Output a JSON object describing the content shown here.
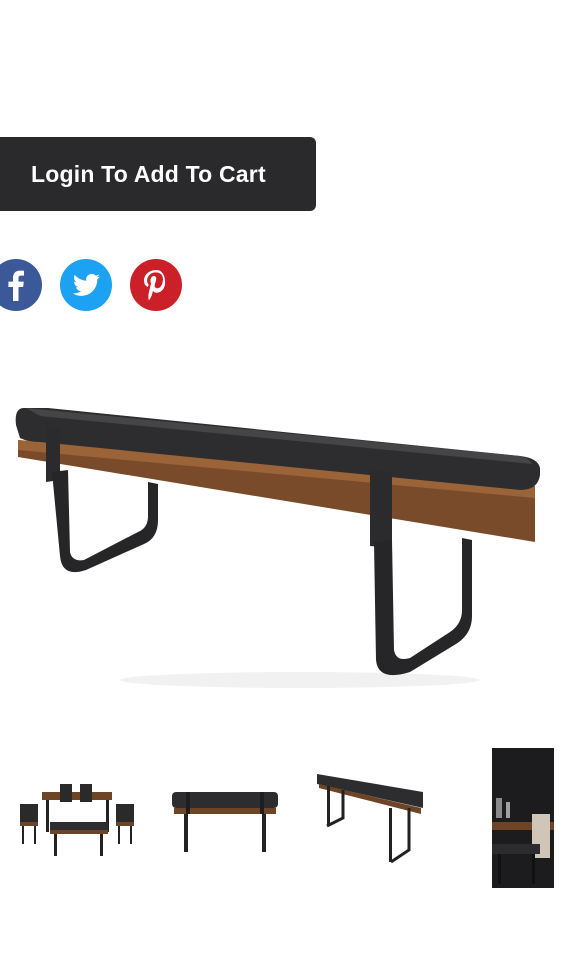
{
  "cart": {
    "label": "Login To Add To Cart"
  },
  "share": [
    {
      "network": "facebook",
      "icon": "facebook-icon",
      "color": "#3b5998"
    },
    {
      "network": "twitter",
      "icon": "twitter-icon",
      "color": "#1da1f2"
    },
    {
      "network": "pinterest",
      "icon": "pinterest-icon",
      "color": "#cb2027"
    }
  ],
  "product_image": {
    "subject": "bench-with-black-leather-cushion"
  },
  "thumbnails": [
    {
      "subject": "dining-set"
    },
    {
      "subject": "bench-front"
    },
    {
      "subject": "bench-angle"
    },
    {
      "subject": "room-scene"
    }
  ]
}
